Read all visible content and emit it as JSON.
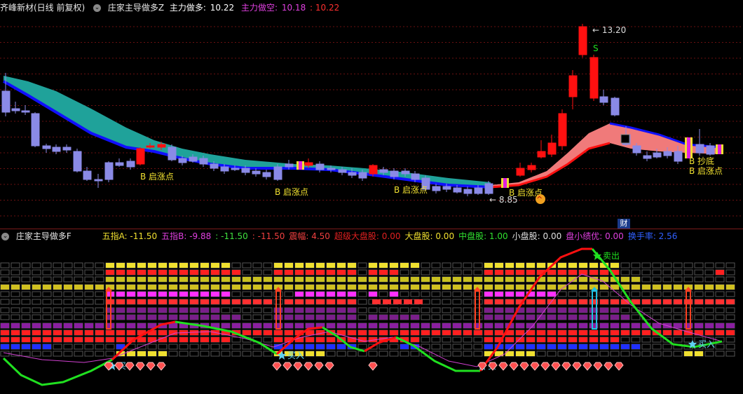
{
  "top": {
    "stock": "齐峰新材(日线 前复权)",
    "indicator": "庄家主导做多Z",
    "long_label": "主力做多:",
    "long_value": "10.22",
    "short_label": "主力做空:",
    "short_value": "10.18",
    "short_value2": ": 10.22"
  },
  "price_annotations": {
    "high": "13.20",
    "low": "8.85",
    "sell_mark": "S",
    "signals": [
      "B 启涨点",
      "B 启涨点",
      "B 启涨点",
      "B 启涨点",
      "B 抄底",
      "B 启涨点"
    ]
  },
  "finance_tag": "财",
  "bottom": {
    "indicator": "庄家主导做多F",
    "values": [
      {
        "text": "五指A: -11.50",
        "color": "#f0e030"
      },
      {
        "text": "五指B: -9.88",
        "color": "#e040e0"
      },
      {
        "text": ": -11.50",
        "color": "#40e040"
      },
      {
        "text": ": -11.50",
        "color": "#f04040"
      },
      {
        "text": "震幅: 4.50",
        "color": "#f04040"
      },
      {
        "text": "超级大盘股: 0.00",
        "color": "#e02020"
      },
      {
        "text": "大盘股: 0.00",
        "color": "#f0e030"
      },
      {
        "text": "中盘股: 1.00",
        "color": "#30e030"
      },
      {
        "text": "小盘股: 0.00",
        "color": "#e0e0e0"
      },
      {
        "text": "盘小绩优: 0.00",
        "color": "#e040e0"
      },
      {
        "text": "换手率: 2.56",
        "color": "#3060ff"
      }
    ],
    "sell_label": "卖出",
    "buy_labels": [
      "买",
      "买入",
      "买",
      "买入"
    ]
  },
  "colors": {
    "bear": "#8a8ae6",
    "bull": "#ff1010",
    "ribbon_down": "#1fa29a",
    "ribbon_up": "#f07a7a",
    "line_blue": "#1010ff"
  }
}
